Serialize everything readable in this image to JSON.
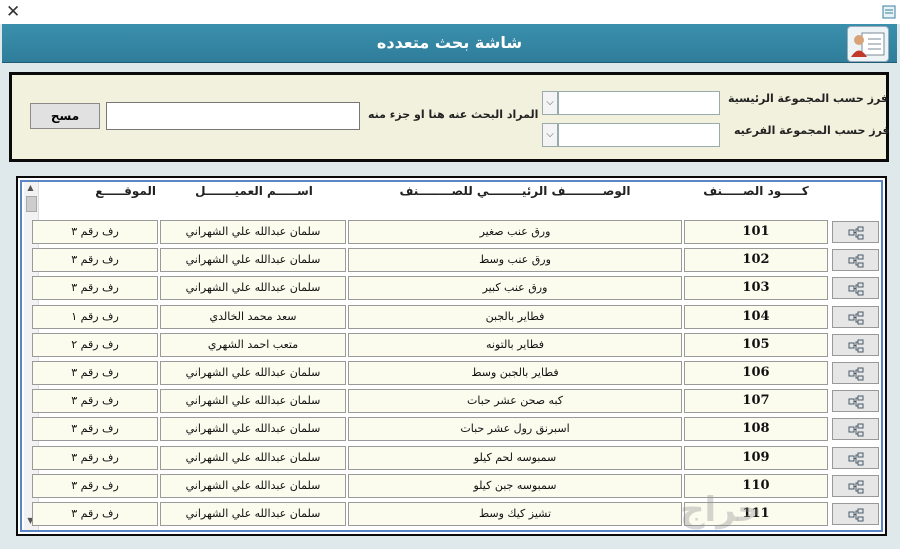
{
  "window": {
    "close_glyph": "✕",
    "title": "شاشة بحث متعدده"
  },
  "filters": {
    "main_group_label": "فرز حسب المجموعة الرئيسية",
    "sub_group_label": "فرز حسب المجموعة الفرعيه",
    "main_group_value": "",
    "sub_group_value": "",
    "search_label": "المراد البحث عنه هنا او جزء منه",
    "search_value": "",
    "clear_button": "مسح"
  },
  "grid": {
    "columns": {
      "code": "كـــــود الصـــــنف",
      "description": "الوصـــــــــف الرئيــــــــي للصــــــــنف",
      "employee": "اســـــم العميـــــــل",
      "location": "الموقـــــع"
    },
    "rows": [
      {
        "code": "101",
        "description": "ورق عنب صغير",
        "employee": "سلمان عبدالله علي الشهراني",
        "location": "رف رقم ٣"
      },
      {
        "code": "102",
        "description": "ورق عنب وسط",
        "employee": "سلمان عبدالله علي الشهراني",
        "location": "رف رقم ٣"
      },
      {
        "code": "103",
        "description": "ورق عنب كبير",
        "employee": "سلمان عبدالله علي الشهراني",
        "location": "رف رقم ٣"
      },
      {
        "code": "104",
        "description": "فطاير بالجبن",
        "employee": "سعد محمد الخالدي",
        "location": "رف رقم ١"
      },
      {
        "code": "105",
        "description": "فطاير بالتونه",
        "employee": "متعب احمد الشهري",
        "location": "رف رقم ٢"
      },
      {
        "code": "106",
        "description": "فطاير بالجبن وسط",
        "employee": "سلمان عبدالله علي الشهراني",
        "location": "رف رقم ٣"
      },
      {
        "code": "107",
        "description": "كبه صحن عشر حبات",
        "employee": "سلمان عبدالله علي الشهراني",
        "location": "رف رقم ٣"
      },
      {
        "code": "108",
        "description": "اسبرنق رول عشر حبات",
        "employee": "سلمان عبدالله علي الشهراني",
        "location": "رف رقم ٣"
      },
      {
        "code": "109",
        "description": "سمبوسه لحم كيلو",
        "employee": "سلمان عبدالله علي الشهراني",
        "location": "رف رقم ٣"
      },
      {
        "code": "110",
        "description": "سمبوسه جبن كيلو",
        "employee": "سلمان عبدالله علي الشهراني",
        "location": "رف رقم ٣"
      },
      {
        "code": "111",
        "description": "تشيز كيك وسط",
        "employee": "سلمان عبدالله علي الشهراني",
        "location": "رف رقم ٣"
      }
    ]
  },
  "watermark_text": "حراج"
}
